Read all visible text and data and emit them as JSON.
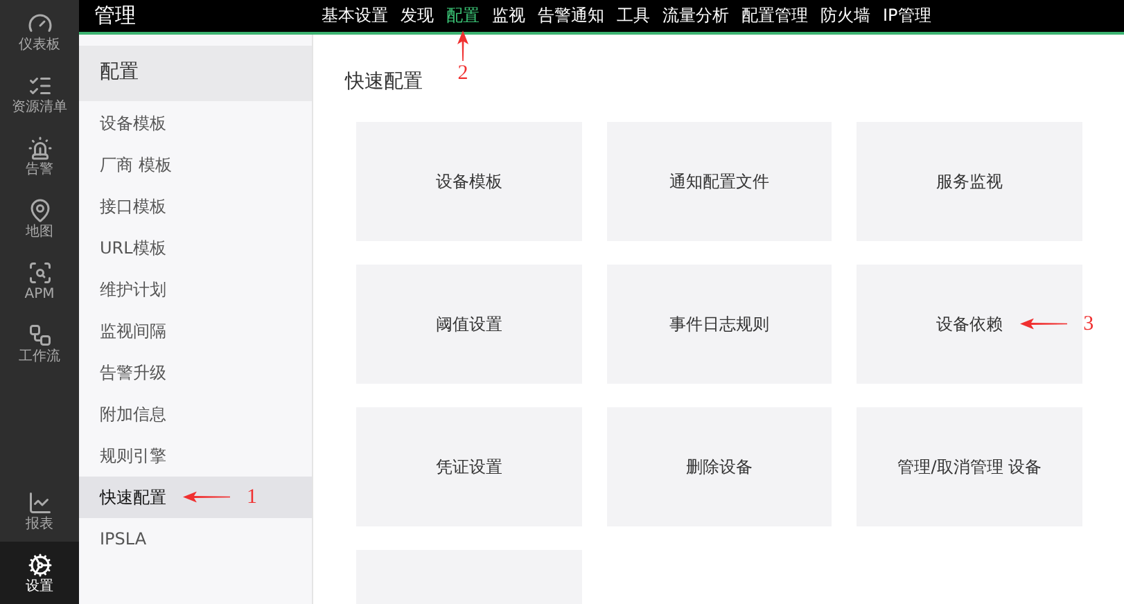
{
  "rail": {
    "top": [
      {
        "label": "仪表板",
        "kind": "gauge",
        "selected": false
      },
      {
        "label": "资源清单",
        "kind": "list",
        "selected": false
      },
      {
        "label": "告警",
        "kind": "siren",
        "selected": false
      },
      {
        "label": "地图",
        "kind": "pin",
        "selected": false
      },
      {
        "label": "APM",
        "kind": "scan",
        "selected": false
      },
      {
        "label": "工作流",
        "kind": "flow",
        "selected": false
      }
    ],
    "bottom": [
      {
        "label": "报表",
        "kind": "chart",
        "selected": false
      },
      {
        "label": "设置",
        "kind": "cog",
        "selected": true
      }
    ]
  },
  "header": {
    "title": "管理",
    "nav": [
      {
        "label": "基本设置",
        "selected": false
      },
      {
        "label": "发现",
        "selected": false
      },
      {
        "label": "配置",
        "selected": true,
        "annotation": "2"
      },
      {
        "label": "监视",
        "selected": false
      },
      {
        "label": "告警通知",
        "selected": false
      },
      {
        "label": "工具",
        "selected": false
      },
      {
        "label": "流量分析",
        "selected": false
      },
      {
        "label": "配置管理",
        "selected": false
      },
      {
        "label": "防火墙",
        "selected": false
      },
      {
        "label": "IP管理",
        "selected": false
      }
    ]
  },
  "sidebar": {
    "title": "配置",
    "items": [
      {
        "label": "设备模板",
        "selected": false
      },
      {
        "label": "厂商 模板",
        "selected": false
      },
      {
        "label": "接口模板",
        "selected": false
      },
      {
        "label": "URL模板",
        "selected": false
      },
      {
        "label": "维护计划",
        "selected": false
      },
      {
        "label": "监视间隔",
        "selected": false
      },
      {
        "label": "告警升级",
        "selected": false
      },
      {
        "label": "附加信息",
        "selected": false
      },
      {
        "label": "规则引擎",
        "selected": false
      },
      {
        "label": "快速配置",
        "selected": true,
        "annotation": "1"
      },
      {
        "label": "IPSLA",
        "selected": false
      }
    ]
  },
  "main": {
    "title": "快速配置",
    "tiles": [
      {
        "kind": "label",
        "label": "设备模板"
      },
      {
        "kind": "label",
        "label": "通知配置文件"
      },
      {
        "kind": "label",
        "label": "服务监视"
      },
      {
        "kind": "label",
        "label": "阈值设置"
      },
      {
        "kind": "label",
        "label": "事件日志规则"
      },
      {
        "kind": "label",
        "label": "设备依赖",
        "annotation": "3"
      },
      {
        "kind": "label",
        "label": "凭证设置"
      },
      {
        "kind": "label",
        "label": "删除设备"
      },
      {
        "kind": "label",
        "label": "管理/取消管理 设备"
      },
      {
        "kind": "blank"
      }
    ]
  }
}
